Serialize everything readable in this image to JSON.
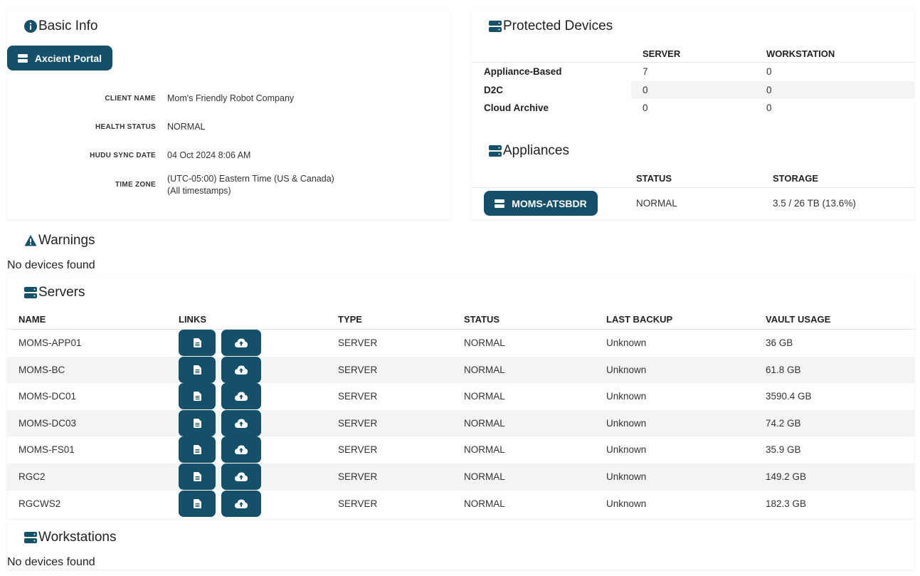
{
  "basic_info": {
    "title": "Basic Info",
    "portal_button": "Axcient Portal",
    "fields": [
      {
        "label": "CLIENT NAME",
        "value": "Mom's Friendly Robot Company"
      },
      {
        "label": "HEALTH STATUS",
        "value": "NORMAL"
      },
      {
        "label": "HUDU SYNC DATE",
        "value": "04 Oct 2024 8:06 AM"
      },
      {
        "label": "TIME ZONE",
        "value": "(UTC-05:00) Eastern Time (US & Canada)",
        "value2": "(All timestamps)"
      }
    ]
  },
  "protected_devices": {
    "title": "Protected Devices",
    "columns": [
      "SERVER",
      "WORKSTATION"
    ],
    "rows": [
      {
        "label": "Appliance-Based",
        "server": "7",
        "workstation": "0"
      },
      {
        "label": "D2C",
        "server": "0",
        "workstation": "0"
      },
      {
        "label": "Cloud Archive",
        "server": "0",
        "workstation": "0"
      }
    ]
  },
  "appliances": {
    "title": "Appliances",
    "columns": [
      "STATUS",
      "STORAGE"
    ],
    "rows": [
      {
        "name": "MOMS-ATSBDR",
        "status": "NORMAL",
        "storage": "3.5 / 26 TB (13.6%)"
      }
    ]
  },
  "warnings": {
    "title": "Warnings",
    "empty": "No devices found"
  },
  "servers": {
    "title": "Servers",
    "columns": [
      "NAME",
      "LINKS",
      "TYPE",
      "STATUS",
      "LAST BACKUP",
      "VAULT USAGE"
    ],
    "rows": [
      {
        "name": "MOMS-APP01",
        "type": "SERVER",
        "status": "NORMAL",
        "last_backup": "Unknown",
        "vault": "36 GB"
      },
      {
        "name": "MOMS-BC",
        "type": "SERVER",
        "status": "NORMAL",
        "last_backup": "Unknown",
        "vault": "61.8 GB"
      },
      {
        "name": "MOMS-DC01",
        "type": "SERVER",
        "status": "NORMAL",
        "last_backup": "Unknown",
        "vault": "3590.4 GB"
      },
      {
        "name": "MOMS-DC03",
        "type": "SERVER",
        "status": "NORMAL",
        "last_backup": "Unknown",
        "vault": "74.2 GB"
      },
      {
        "name": "MOMS-FS01",
        "type": "SERVER",
        "status": "NORMAL",
        "last_backup": "Unknown",
        "vault": "35.9 GB"
      },
      {
        "name": "RGC2",
        "type": "SERVER",
        "status": "NORMAL",
        "last_backup": "Unknown",
        "vault": "149.2 GB"
      },
      {
        "name": "RGCWS2",
        "type": "SERVER",
        "status": "NORMAL",
        "last_backup": "Unknown",
        "vault": "182.3 GB"
      }
    ]
  },
  "workstations": {
    "title": "Workstations",
    "empty": "No devices found"
  },
  "colors": {
    "accent": "#14506a",
    "stripe": "#f4f4f4"
  },
  "icons": {
    "info": "info-circle-icon",
    "server": "server-icon",
    "warning": "warning-triangle-icon",
    "document": "document-icon",
    "cloud": "cloud-upload-icon"
  }
}
